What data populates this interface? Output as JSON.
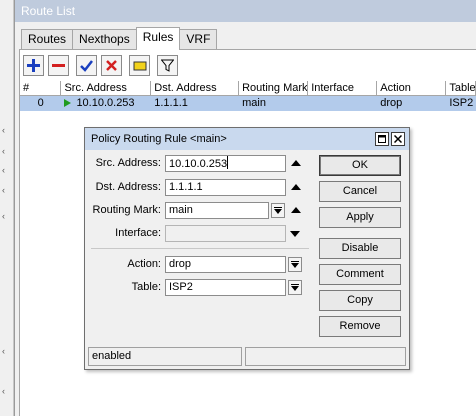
{
  "window": {
    "title": "Route List"
  },
  "tabs": [
    {
      "label": "Routes",
      "active": false
    },
    {
      "label": "Nexthops",
      "active": false
    },
    {
      "label": "Rules",
      "active": true
    },
    {
      "label": "VRF",
      "active": false
    }
  ],
  "toolbar": {
    "buttons": [
      {
        "icon": "plus-icon",
        "color": "#1a3fbf"
      },
      {
        "icon": "minus-icon",
        "color": "#d32020"
      },
      {
        "icon": "check-icon",
        "color": "#1a3fbf"
      },
      {
        "icon": "x-icon",
        "color": "#d32020"
      },
      {
        "icon": "comment-icon",
        "color": "#f2d21a"
      },
      {
        "icon": "filter-icon",
        "color": "#000000"
      }
    ]
  },
  "table": {
    "columns": [
      "#",
      "Src. Address",
      "Dst. Address",
      "Routing Mark",
      "Interface",
      "Action",
      "Table"
    ],
    "rows": [
      {
        "num": "0",
        "src": "10.10.0.253",
        "dst": "1.1.1.1",
        "mark": "main",
        "iface": "",
        "action": "drop",
        "table": "ISP2"
      }
    ],
    "selected_row_color": "#b3cbeb"
  },
  "dialog": {
    "title": "Policy Routing Rule <main>",
    "fields": {
      "src_label": "Src. Address:",
      "src_value": "10.10.0.253",
      "dst_label": "Dst. Address:",
      "dst_value": "1.1.1.1",
      "mark_label": "Routing Mark:",
      "mark_value": "main",
      "iface_label": "Interface:",
      "iface_value": "",
      "action_label": "Action:",
      "action_value": "drop",
      "table_label": "Table:",
      "table_value": "ISP2"
    },
    "buttons": {
      "ok": "OK",
      "cancel": "Cancel",
      "apply": "Apply",
      "disable": "Disable",
      "comment": "Comment",
      "copy": "Copy",
      "remove": "Remove"
    },
    "status": {
      "left": "enabled",
      "right": ""
    }
  },
  "left_strip": {
    "ticks": [
      "‹",
      "‹",
      "‹",
      "‹",
      "‹",
      "‹",
      "‹"
    ]
  }
}
